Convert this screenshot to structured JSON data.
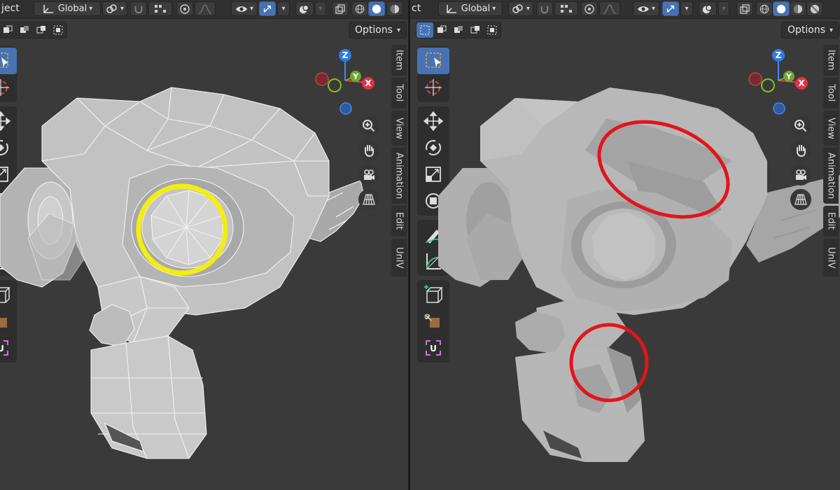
{
  "left": {
    "header": {
      "mode_label": "ject",
      "orientation_label": "Global"
    },
    "options_label": "Options",
    "gizmo": {
      "z": "Z",
      "y": "Y",
      "x": "X"
    },
    "tabs": [
      "Item",
      "Tool",
      "View",
      "Animation",
      "Edit",
      "UnIV"
    ],
    "annotation_color": "#f2ee12"
  },
  "right": {
    "header": {
      "mode_label": "ct",
      "orientation_label": "Global"
    },
    "options_label": "Options",
    "gizmo": {
      "z": "Z",
      "y": "Y",
      "x": "X"
    },
    "tabs": [
      "Item",
      "Tool",
      "View",
      "Animation",
      "Edit",
      "UnIV"
    ],
    "annotation_color": "#e3141b"
  },
  "colors": {
    "accent": "#4772b3",
    "viewport_bg": "#3a3a3a",
    "header_bg": "#303030"
  },
  "icons": [
    "selection-icon",
    "cursor-icon",
    "move-icon",
    "rotate-icon",
    "scale-icon",
    "transform-icon",
    "annotate-icon",
    "measure-icon",
    "add-cube-icon",
    "extrude-icon",
    "uv-icon",
    "zoom-icon",
    "hand-icon",
    "camera-icon",
    "grid-icon"
  ]
}
